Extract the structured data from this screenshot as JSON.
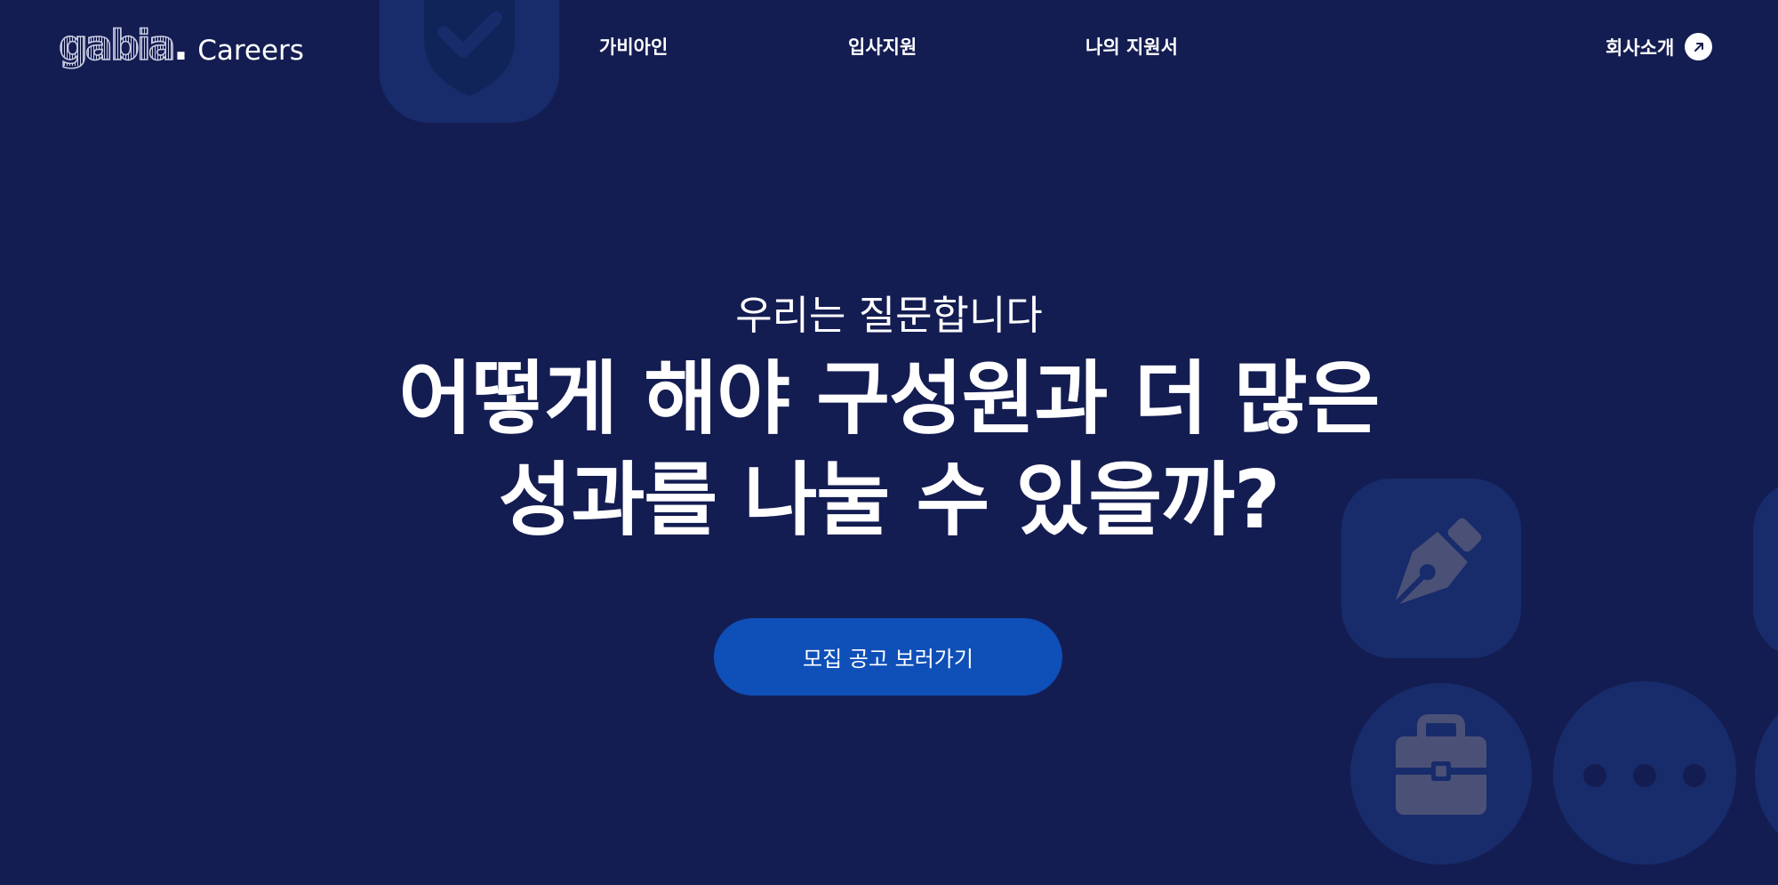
{
  "header": {
    "logo_text": "gabia",
    "logo_dot": ".",
    "logo_suffix": "Careers",
    "nav": [
      {
        "label": "가비아인"
      },
      {
        "label": "입사지원"
      },
      {
        "label": "나의 지원서"
      }
    ],
    "company_link": {
      "label": "회사소개",
      "icon": "arrow-up-right-icon"
    }
  },
  "hero": {
    "subtitle": "우리는 질문합니다",
    "title_lines": [
      "어떻게 해야 구성원과 더 많은",
      "성과를 나눌 수 있을까?"
    ],
    "cta_label": "모집 공고 보러가기"
  },
  "decor_icons": [
    "shield-check-icon",
    "pen-nib-icon",
    "briefcase-icon",
    "more-dots-icon"
  ],
  "colors": {
    "background": "#141d52",
    "tile": "#182c6c",
    "icon": "#4b5176",
    "cta": "#0f4fb8",
    "text": "#ffffff"
  }
}
